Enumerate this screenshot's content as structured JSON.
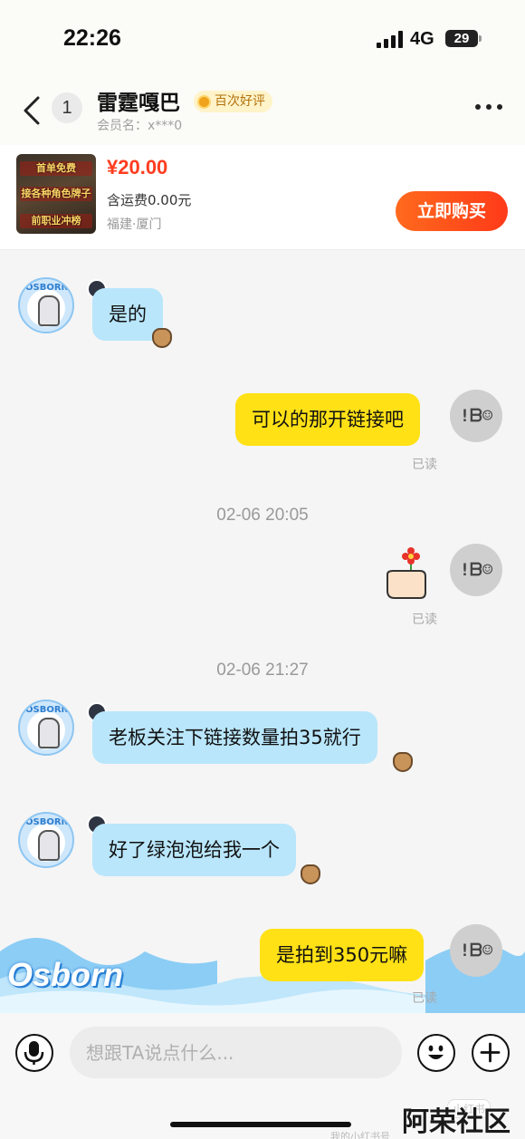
{
  "status_bar": {
    "time": "22:26",
    "network": "4G",
    "battery": "29"
  },
  "header": {
    "unread_count": "1",
    "contact_name": "雷霆嘎巴",
    "rating_badge": "百次好评",
    "member_id": "会员名：x***0"
  },
  "product": {
    "price": "¥20.00",
    "shipping": "含运费0.00元",
    "location": "福建·厦门",
    "buy_label": "立即购买",
    "thumb_lines": [
      "首单免费",
      "接各种角色牌子",
      "前职业冲榜"
    ]
  },
  "messages": [
    {
      "side": "seller",
      "text": "是的"
    },
    {
      "side": "me",
      "text": "可以的那开链接吧",
      "status": "已读"
    },
    {
      "type": "time",
      "text": "02-06 20:05"
    },
    {
      "side": "me",
      "sticker": "flower-hand",
      "status": "已读"
    },
    {
      "type": "time",
      "text": "02-06 21:27"
    },
    {
      "side": "seller",
      "text": "老板关注下链接数量拍35就行"
    },
    {
      "side": "seller",
      "text": "好了绿泡泡给我一个"
    },
    {
      "side": "me",
      "text": "是拍到350元嘛",
      "status": "已读"
    }
  ],
  "avatars": {
    "seller_ring_text": "OSBORN",
    "me_glyph": "!ᗷ☺"
  },
  "decoration": {
    "brand": "Osborn"
  },
  "input": {
    "placeholder": "想跟TA说点什么..."
  },
  "watermarks": {
    "small": "小红书",
    "site": "阿荣社区",
    "id": "我的小红书号"
  },
  "colors": {
    "accent": "#ff3a19",
    "my_bubble": "#ffe116",
    "seller_bubble": "#b9e6fb"
  },
  "icons": [
    "back-arrow-icon",
    "more-icon",
    "microphone-icon",
    "emoji-icon",
    "plus-icon"
  ]
}
